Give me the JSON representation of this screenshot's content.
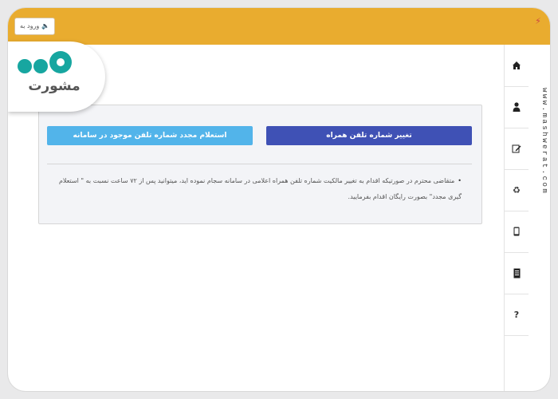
{
  "header": {
    "login_label": "ورود به",
    "login_icon": "speaker-icon",
    "accent_color": "#e9ac2f"
  },
  "brand": {
    "name": "مشورت",
    "color": "#17a6a0"
  },
  "rail": {
    "icons": [
      "home-icon",
      "user-icon",
      "edit-icon",
      "recycle-icon",
      "mobile-icon",
      "sim-card-icon",
      "help-icon"
    ],
    "help_symbol": "?"
  },
  "watermark": "www.mashwerat.com",
  "panel": {
    "change_button": "تغییر شماره تلفن همراه",
    "inquiry_button": "استعلام مجدد شماره تلفن موجود در سامانه",
    "note": "متقاضی محترم در صورتیکه اقدام به تغییر مالکیت شماره تلفن همراه اعلامی در سامانه سجام نموده اید، میتوانید پس از ۷۲ ساعت نسبت به \" استعلام گیری مجدد\" بصورت رایگان اقدام بفرمایید.",
    "change_color": "#3f51b5",
    "inquiry_color": "#52b4ea"
  }
}
